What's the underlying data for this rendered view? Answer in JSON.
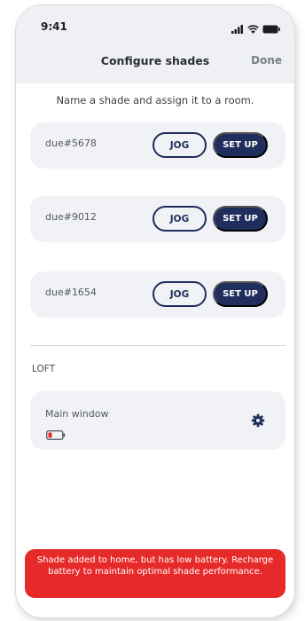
{
  "status_bar": {
    "time": "9:41",
    "icons": [
      "cellular-signal-icon",
      "wifi-icon",
      "battery-icon"
    ]
  },
  "nav": {
    "title": "Configure shades",
    "done_label": "Done"
  },
  "instruction": "Name a shade and assign it to a room.",
  "shades": [
    {
      "name": "due#5678",
      "jog_label": "JOG",
      "setup_label": "SET UP"
    },
    {
      "name": "due#9012",
      "jog_label": "JOG",
      "setup_label": "SET UP"
    },
    {
      "name": "due#1654",
      "jog_label": "JOG",
      "setup_label": "SET UP"
    }
  ],
  "room": {
    "section_label": "LOFT",
    "name": "Main window",
    "battery_state": "low",
    "settings_icon": "gear-icon"
  },
  "toast": {
    "message": "Shade added to home, but has low battery. Recharge battery to maintain optimal shade performance."
  },
  "colors": {
    "primary": "#1f2e5c",
    "card_bg": "#f0f2f5",
    "alert": "#e62a2a",
    "battery_low": "#e62a2a"
  }
}
